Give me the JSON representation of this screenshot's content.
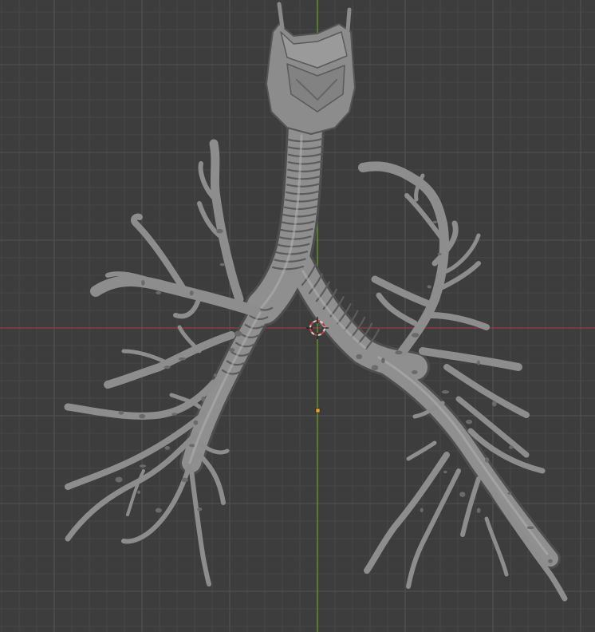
{
  "viewport": {
    "background_color": "#3d3d3d",
    "grid_minor_color": "#474747",
    "grid_major_color": "#525252",
    "x_axis_color": "#9a3a3f",
    "y_axis_color": "#6a9a2a",
    "mesh_color": "#8e8e8e",
    "mesh_shadow_color": "#5a5a5a",
    "mesh_highlight_color": "#b4b4b4",
    "origin_color": "#f2a12b",
    "cursor_colors": [
      "#d8d8d8",
      "#d23b3b"
    ]
  },
  "scene": {
    "object_kind": "bronchial-tree-mesh",
    "icons": [
      "3d-cursor-icon",
      "origin-point-icon"
    ]
  }
}
